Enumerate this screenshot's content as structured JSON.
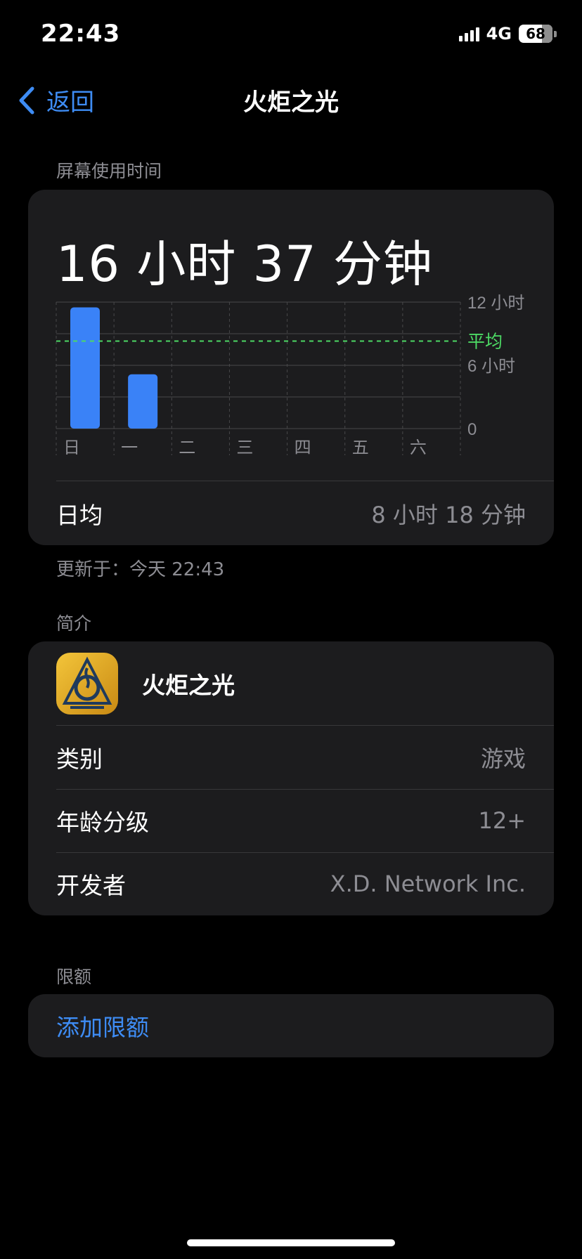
{
  "status_bar": {
    "time": "22:43",
    "network": "4G",
    "battery": "68"
  },
  "nav": {
    "back_label": "返回",
    "title": "火炬之光"
  },
  "screen_time": {
    "section_label": "屏幕使用时间",
    "total": "16 小时 37 分钟",
    "daily_avg_label": "日均",
    "daily_avg_value": "8 小时 18 分钟",
    "updated": "更新于：今天 22:43"
  },
  "chart_data": {
    "type": "bar",
    "categories": [
      "日",
      "一",
      "二",
      "三",
      "四",
      "五",
      "六"
    ],
    "values": [
      11.5,
      5.15,
      0,
      0,
      0,
      0,
      0
    ],
    "unit": "小时",
    "ylim": [
      0,
      12
    ],
    "y_tick_labels": [
      "12 小时",
      "6 小时",
      "0"
    ],
    "average_value": 8.3,
    "average_label": "平均",
    "bar_color": "#3a82f7",
    "average_color": "#4cd964",
    "grid": true
  },
  "info": {
    "section_label": "简介",
    "app_name": "火炬之光",
    "category_label": "类别",
    "category_value": "游戏",
    "age_label": "年龄分级",
    "age_value": "12+",
    "developer_label": "开发者",
    "developer_value": "X.D. Network Inc."
  },
  "limits": {
    "section_label": "限额",
    "add_label": "添加限额"
  },
  "colors": {
    "accent": "#3e8cf4",
    "card_bg": "#1c1c1e",
    "secondary_text": "#8d8d93"
  }
}
